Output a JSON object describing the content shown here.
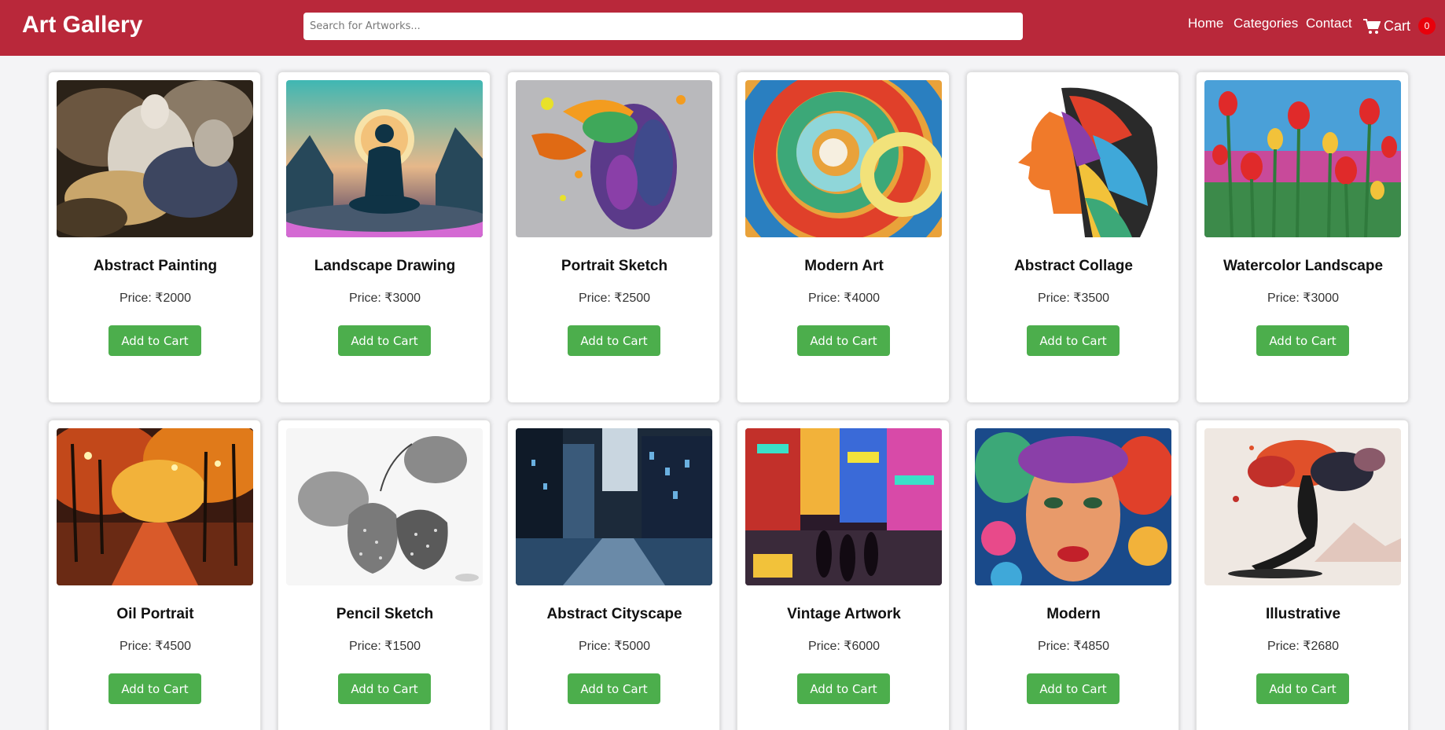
{
  "header": {
    "brand": "Art Gallery",
    "search_placeholder": "Search for Artworks...",
    "nav": [
      "Home",
      "Categories",
      "Contact"
    ],
    "cart_label": "Cart",
    "cart_count": "0",
    "colors": {
      "header_bg": "#b9283a",
      "badge": "#e8000b"
    }
  },
  "button_label": "Add to Cart",
  "button_color": "#4cae4c",
  "products": [
    {
      "title": "Abstract Painting",
      "price": "Price: ₹2000",
      "image": "baroque-figure-painting"
    },
    {
      "title": "Landscape Drawing",
      "price": "Price: ₹3000",
      "image": "meditating-figure-landscape"
    },
    {
      "title": "Portrait Sketch",
      "price": "Price: ₹2500",
      "image": "paint-splash-portrait"
    },
    {
      "title": "Modern Art",
      "price": "Price: ₹4000",
      "image": "color-swirl"
    },
    {
      "title": "Abstract Collage",
      "price": "Price: ₹3500",
      "image": "profile-collage"
    },
    {
      "title": "Watercolor Landscape",
      "price": "Price: ₹3000",
      "image": "tulip-field"
    },
    {
      "title": "Oil Portrait",
      "price": "Price: ₹4500",
      "image": "autumn-street"
    },
    {
      "title": "Pencil Sketch",
      "price": "Price: ₹1500",
      "image": "strawberry-sketch"
    },
    {
      "title": "Abstract Cityscape",
      "price": "Price: ₹5000",
      "image": "rainy-city"
    },
    {
      "title": "Vintage Artwork",
      "price": "Price: ₹6000",
      "image": "neon-street"
    },
    {
      "title": "Modern",
      "price": "Price: ₹4850",
      "image": "floral-face"
    },
    {
      "title": "Illustrative",
      "price": "Price: ₹2680",
      "image": "ink-tree"
    }
  ]
}
